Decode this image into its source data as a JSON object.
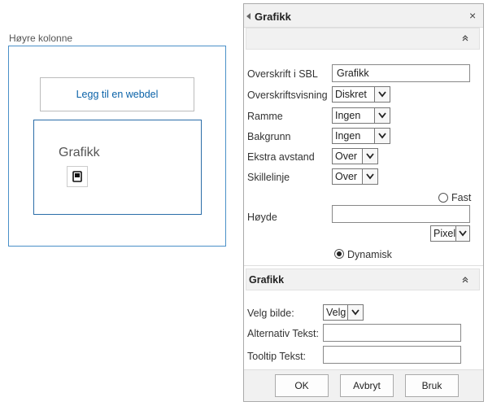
{
  "left": {
    "column_title": "Høyre kolonne",
    "add_webpart_label": "Legg til en webdel",
    "webpart_title": "Grafikk"
  },
  "panel": {
    "title": "Grafikk",
    "close_symbol": "×",
    "fields": {
      "overskrift_label": "Overskrift i SBL",
      "overskrift_value": "Grafikk",
      "visning_label": "Overskriftsvisning",
      "visning_value": "Diskret",
      "ramme_label": "Ramme",
      "ramme_value": "Ingen",
      "bakgrunn_label": "Bakgrunn",
      "bakgrunn_value": "Ingen",
      "avstand_label": "Ekstra avstand",
      "avstand_value": "Over",
      "skillelinje_label": "Skillelinje",
      "skillelinje_value": "Over",
      "fast_label": "Fast",
      "hoyde_label": "Høyde",
      "hoyde_value": "",
      "unit_value": "Pixel",
      "dynamisk_label": "Dynamisk"
    },
    "section2_title": "Grafikk",
    "graphic": {
      "bilde_label": "Velg bilde:",
      "bilde_value": "Velg",
      "alt_label": "Alternativ Tekst:",
      "alt_value": "",
      "tooltip_label": "Tooltip Tekst:",
      "tooltip_value": ""
    },
    "buttons": {
      "ok": "OK",
      "cancel": "Avbryt",
      "apply": "Bruk"
    }
  },
  "colors": {
    "accent": "#0a62a8",
    "border_blue": "#2b6da8"
  }
}
